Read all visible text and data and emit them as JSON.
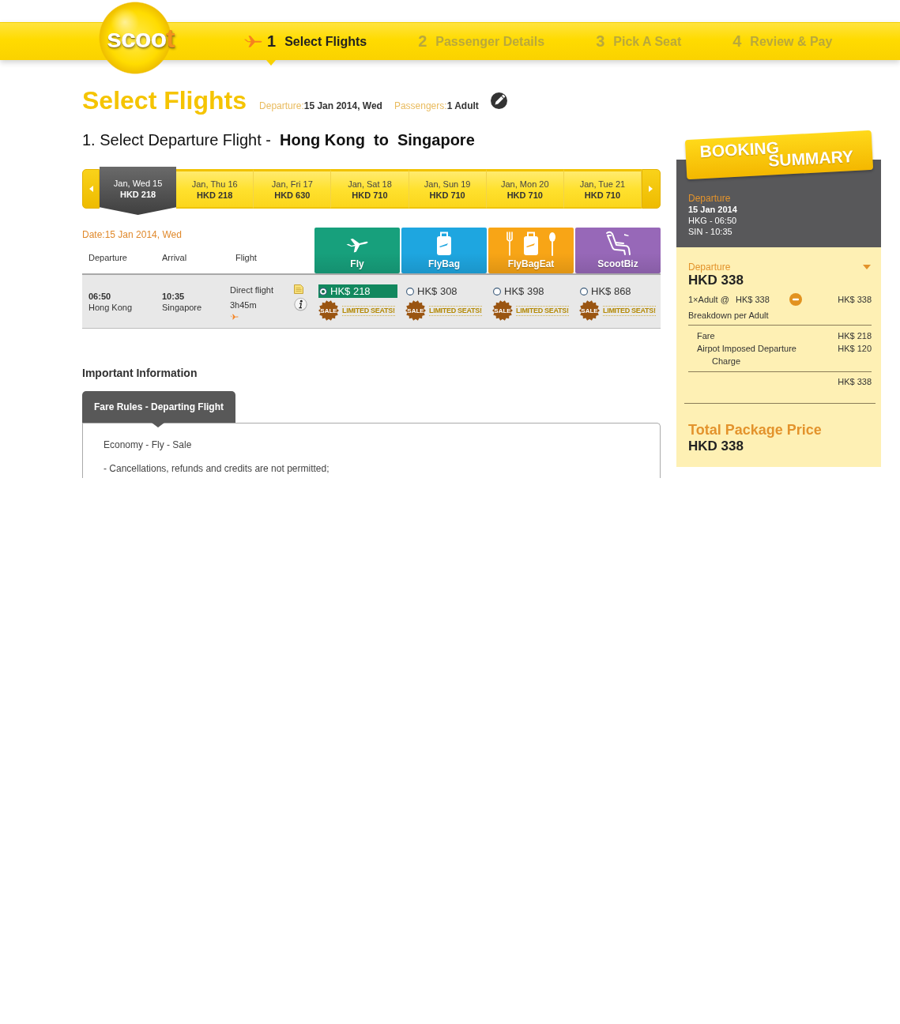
{
  "header": {
    "logo": "scoot",
    "steps": [
      {
        "number": "1",
        "label": "Select Flights",
        "selected": true
      },
      {
        "number": "2",
        "label": "Passenger Details",
        "selected": false
      },
      {
        "number": "3",
        "label": "Pick A Seat",
        "selected": false
      },
      {
        "number": "4",
        "label": "Review & Pay",
        "selected": false
      }
    ]
  },
  "title": "Select Flights",
  "search_summary": [
    {
      "label": "Departure:",
      "value": "15 Jan 2014, Wed"
    },
    {
      "label": "Passengers:",
      "value": "1 Adult"
    }
  ],
  "route_heading": "1. Select Departure Flight -  **Hong Kong  to  Singapore**",
  "date_strip": [
    {
      "date": "Jan, Wed 15",
      "price": "HKD 218",
      "selected": true
    },
    {
      "date": "Jan, Thu 16",
      "price": "HKD 218",
      "selected": false
    },
    {
      "date": "Jan, Fri 17",
      "price": "HKD 630",
      "selected": false
    },
    {
      "date": "Jan, Sat 18",
      "price": "HKD 710",
      "selected": false
    },
    {
      "date": "Jan, Sun 19",
      "price": "HKD 710",
      "selected": false
    },
    {
      "date": "Jan, Mon 20",
      "price": "HKD 710",
      "selected": false
    },
    {
      "date": "Jan, Tue 21",
      "price": "HKD 710",
      "selected": false
    }
  ],
  "flight_table": {
    "date": "Date:15 Jan 2014, Wed",
    "columns": [
      "Departure",
      "Arrival",
      "Flight"
    ],
    "products": [
      {
        "name": "Fly",
        "kind": "plane",
        "color": "#17a07c"
      },
      {
        "name": "FlyBag",
        "kind": "bag",
        "color": "#1ea6e0"
      },
      {
        "name": "FlyBagEat",
        "kind": "bag-meal",
        "color": "#f8a516"
      },
      {
        "name": "ScootBiz",
        "kind": "seat",
        "color": "#9768b8"
      }
    ],
    "rows": [
      {
        "departure_time": "06:50",
        "departure_city": "Hong Kong",
        "arrival_time": "10:35",
        "arrival_city": "Singapore",
        "flight_type": "Direct flight",
        "duration": "3h45m",
        "fares": [
          {
            "price": "HK$ 218",
            "selected": true,
            "sale_badge": "SALE",
            "note": "LIMITED SEATS!"
          },
          {
            "price": "HK$ 308",
            "selected": false,
            "sale_badge": "SALE",
            "note": "LIMITED SEATS!"
          },
          {
            "price": "HK$ 398",
            "selected": false,
            "sale_badge": "SALE",
            "note": "LIMITED SEATS!"
          },
          {
            "price": "HK$ 868",
            "selected": false,
            "sale_badge": "SALE",
            "note": "LIMITED SEATS!"
          }
        ]
      }
    ]
  },
  "important_information": {
    "title": "Important Information",
    "tabs": [
      {
        "label": "Fare Rules - Departing Flight",
        "selected": true
      }
    ],
    "paragraphs": [
      "Economy - Fly - Sale",
      "- Cancellations, refunds and credits are not permitted;"
    ]
  },
  "booking_summary": {
    "banner": [
      "BOOKING",
      "SUMMARY"
    ],
    "flight": {
      "label": "Departure",
      "date": "15 Jan 2014",
      "lines": [
        "HKG - 06:50",
        "SIN - 10:35"
      ]
    },
    "fare": {
      "label": "Departure",
      "expanded": true,
      "total": "HKD 338",
      "passenger_line": {
        "label": "1×Adult @",
        "unit_price": "HK$ 338",
        "amount": "HK$ 338"
      },
      "breakdown_title": "Breakdown per Adult",
      "breakdown": [
        {
          "label": "Fare",
          "amount": "HK$ 218"
        },
        {
          "label": "Airpot Imposed Departure Charge",
          "amount": "HK$ 120"
        }
      ],
      "subtotal": "HK$ 338"
    },
    "total_label": "Total Package Price",
    "total": "HKD 338"
  }
}
